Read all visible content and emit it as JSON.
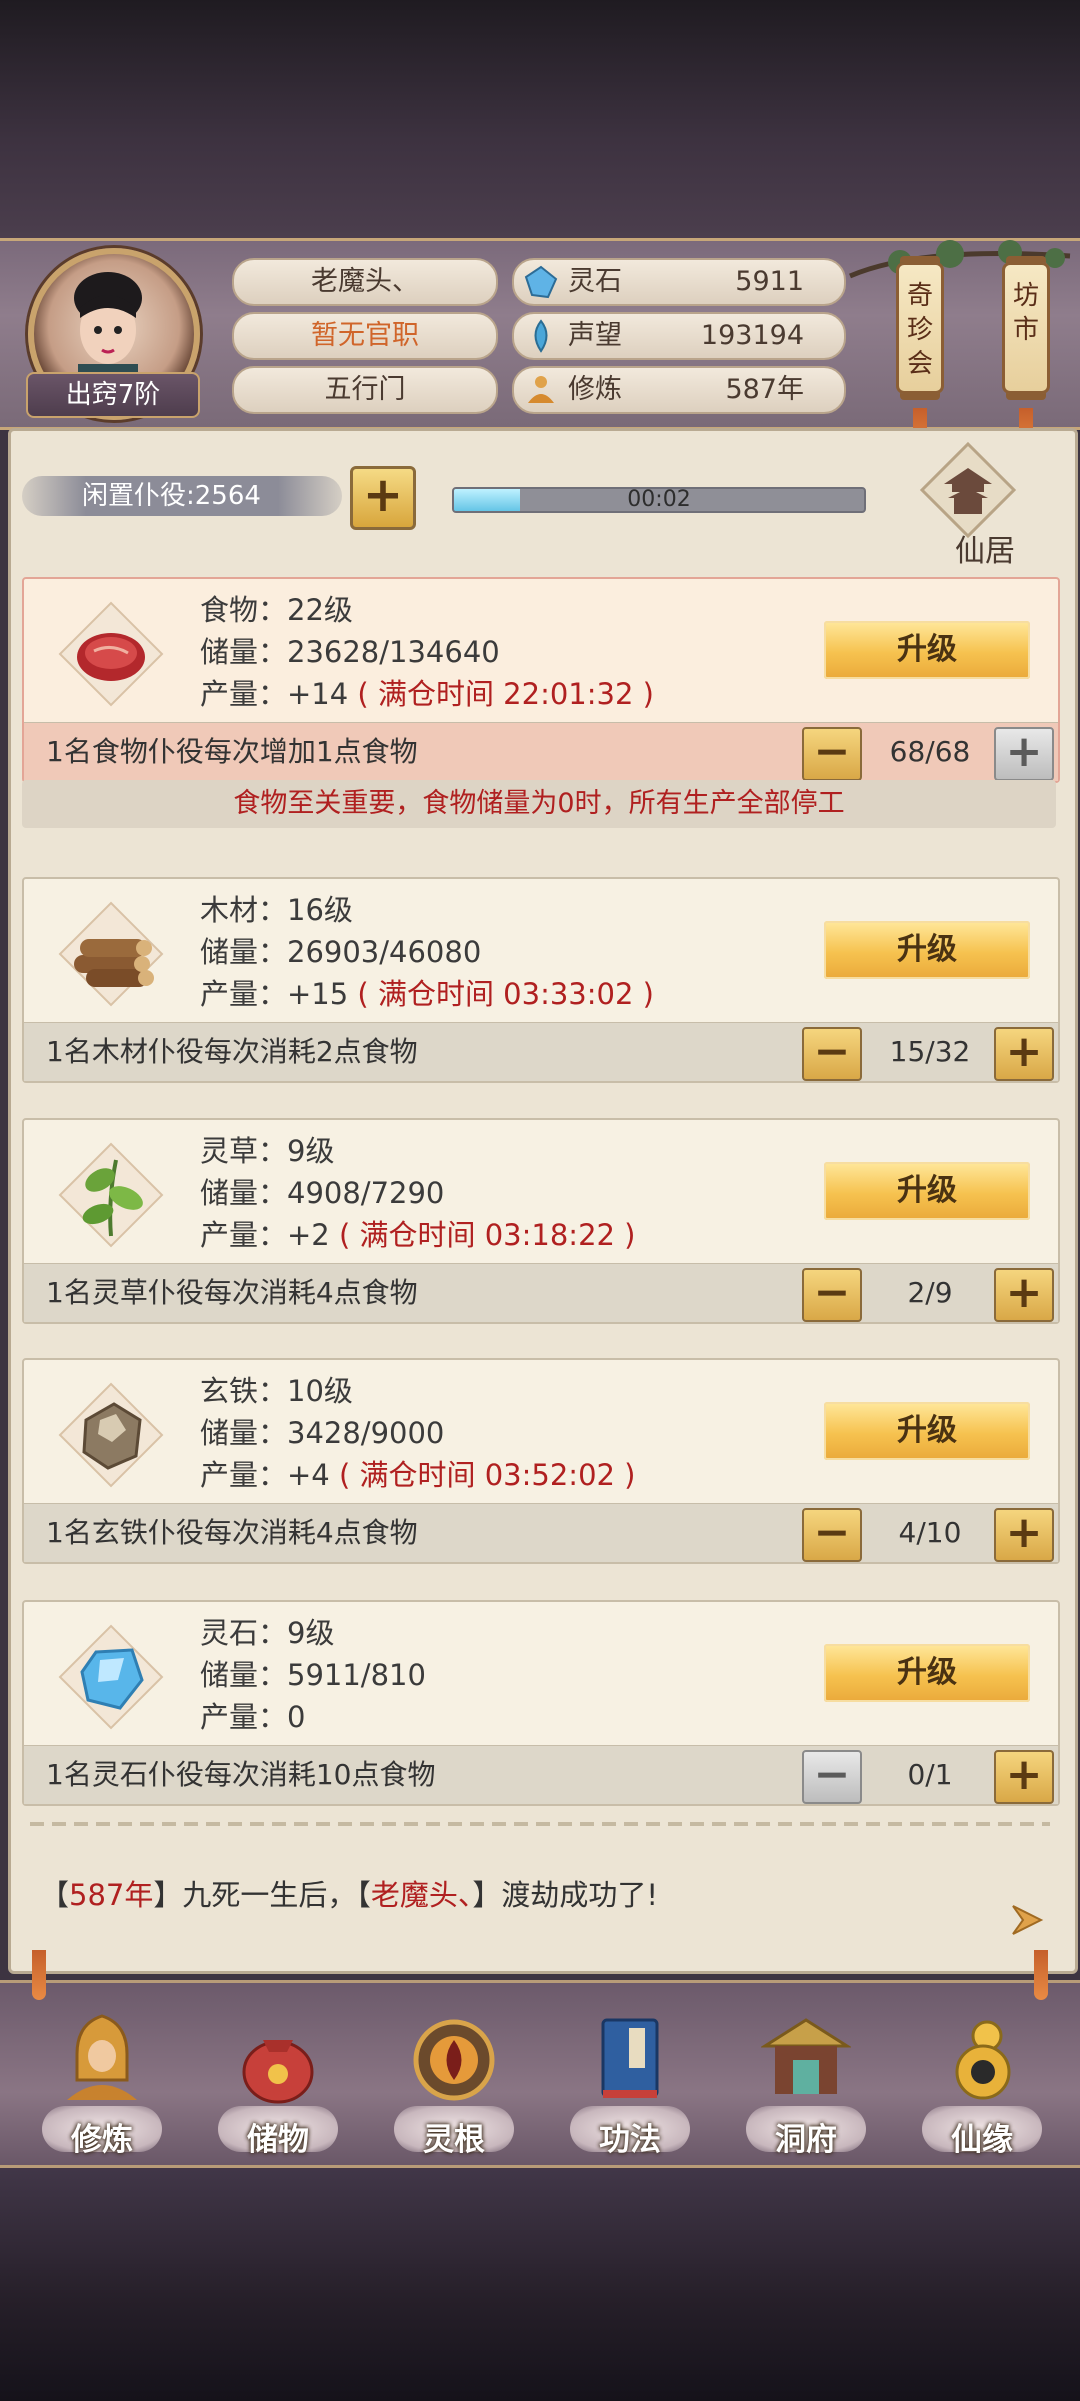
{
  "player": {
    "name": "老魔头、",
    "title": "暂无官职",
    "sect": "五行门",
    "realm": "出窍7阶"
  },
  "stats": [
    {
      "label": "灵石",
      "value": "5911",
      "icon": "spirit-stone-icon"
    },
    {
      "label": "声望",
      "value": "193194",
      "icon": "reputation-icon"
    },
    {
      "label": "修炼",
      "value": "587年",
      "icon": "meditation-icon"
    }
  ],
  "scroll_buttons": {
    "qizhenhui": "奇珍会",
    "fangshi": "坊市"
  },
  "idle": {
    "label": "闲置仆役:2564",
    "timer": "00:02",
    "progress": 0.16
  },
  "xianju": {
    "label": "仙居"
  },
  "upgrade_label": "升级",
  "resources": [
    {
      "name": "食物：22级",
      "storage": "储量：23628/134640",
      "prod": "产量：+14",
      "full": "( 满仓时间 22:01:32 )",
      "desc": "1名食物仆役每次增加1点食物",
      "count": "68/68"
    },
    {
      "name": "木材：16级",
      "storage": "储量：26903/46080",
      "prod": "产量：+15",
      "full": "( 满仓时间 03:33:02 )",
      "desc": "1名木材仆役每次消耗2点食物",
      "count": "15/32"
    },
    {
      "name": "灵草：9级",
      "storage": "储量：4908/7290",
      "prod": "产量：+2",
      "full": "( 满仓时间 03:18:22 )",
      "desc": "1名灵草仆役每次消耗4点食物",
      "count": "2/9"
    },
    {
      "name": "玄铁：10级",
      "storage": "储量：3428/9000",
      "prod": "产量：+4",
      "full": "( 满仓时间 03:52:02 )",
      "desc": "1名玄铁仆役每次消耗4点食物",
      "count": "4/10"
    },
    {
      "name": "灵石：9级",
      "storage": "储量：5911/810",
      "prod": "产量：0",
      "full": "",
      "desc": "1名灵石仆役每次消耗10点食物",
      "count": "0/1"
    }
  ],
  "food_warning": "食物至关重要，食物储量为0时，所有生产全部停工",
  "log": {
    "p1": "【",
    "year": "587年",
    "p2": "】九死一生后，【",
    "name": "老魔头、",
    "p3": "】渡劫成功了!"
  },
  "nav": [
    "修炼",
    "储物",
    "灵根",
    "功法",
    "洞府",
    "仙缘"
  ],
  "colors": {
    "accent_red": "#b02020",
    "gold": "#f6c24f",
    "panel": "#ece4d4"
  }
}
